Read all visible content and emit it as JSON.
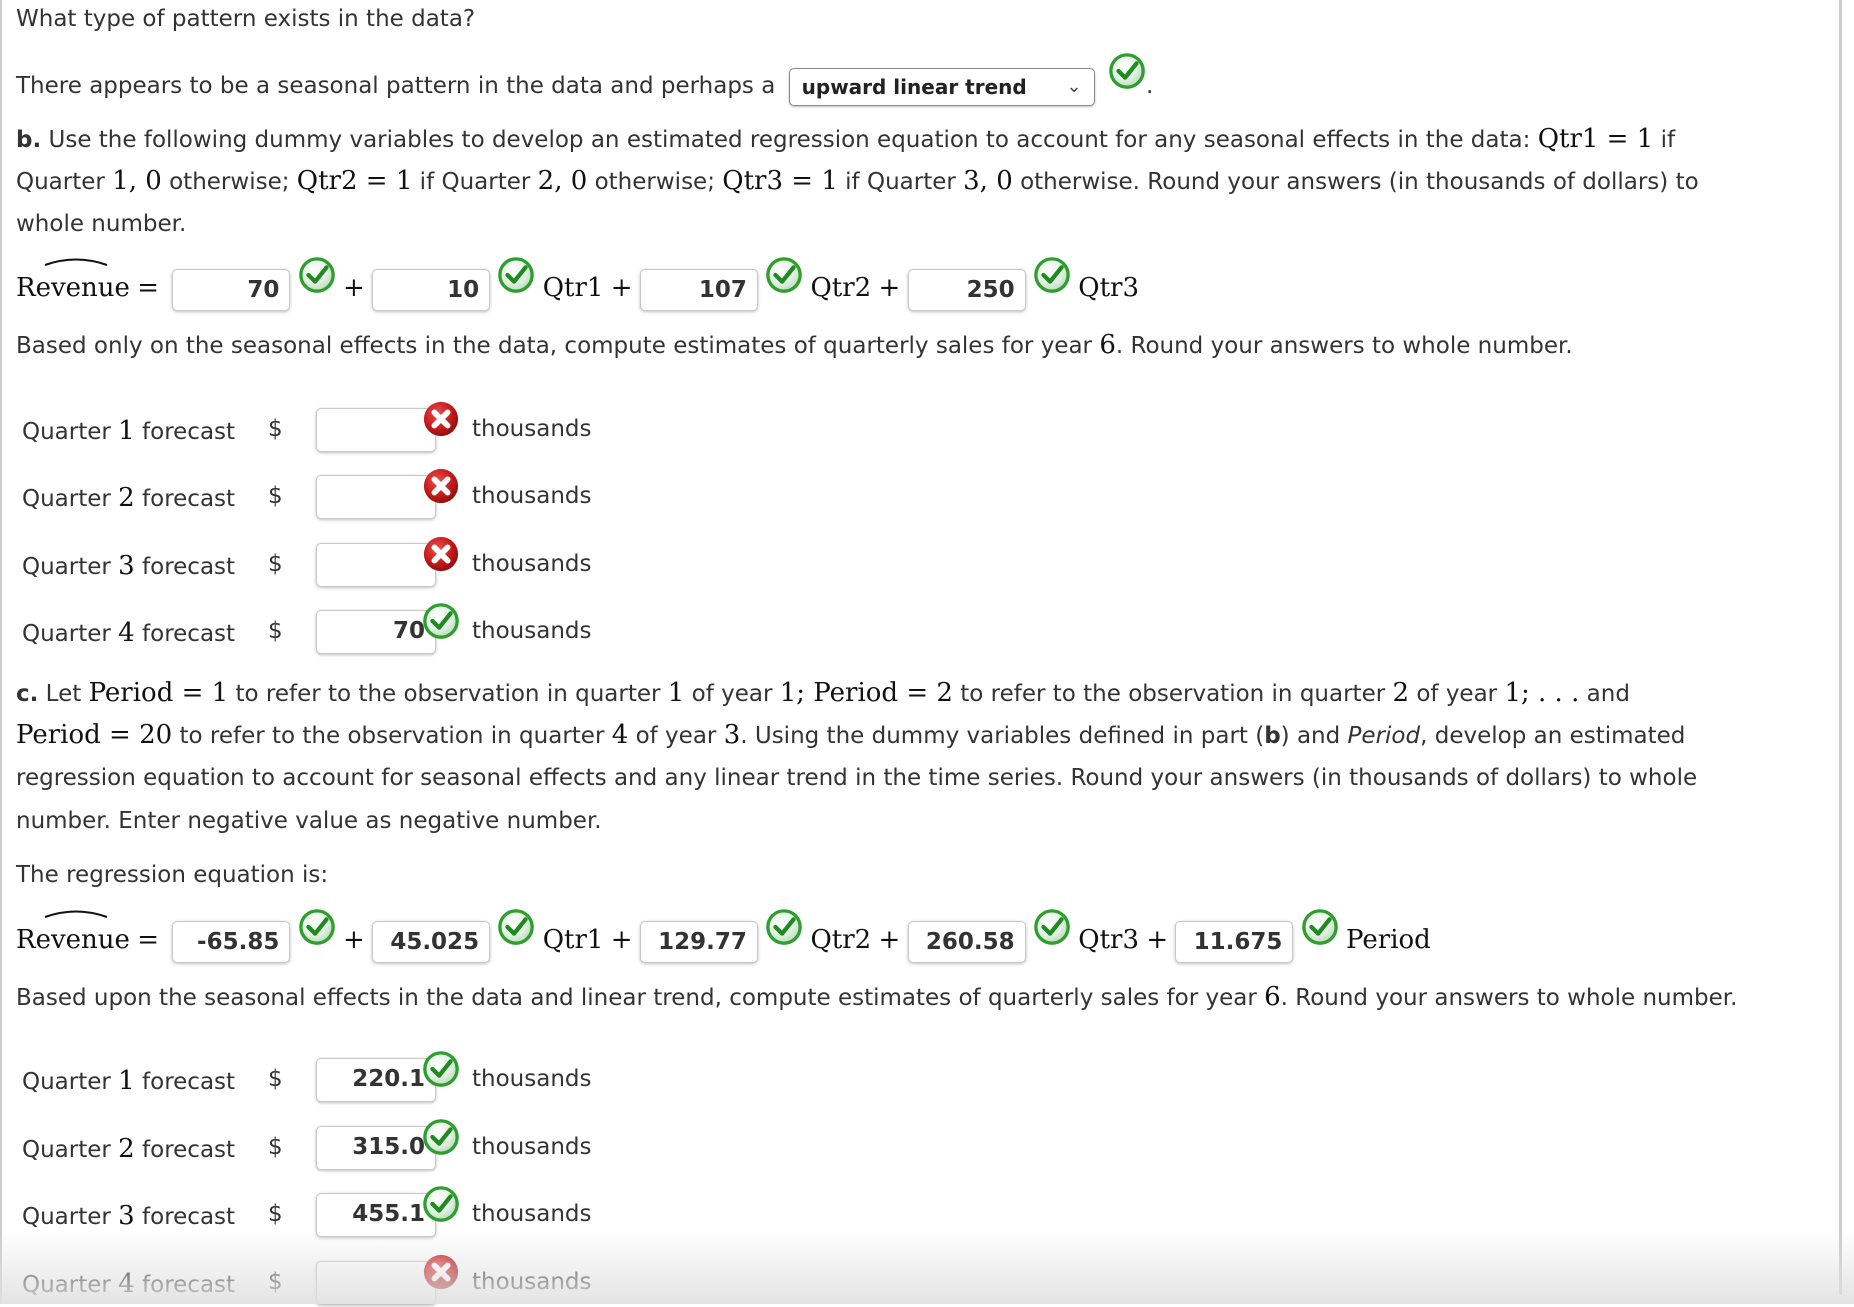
{
  "question": "What type of pattern exists in the data?",
  "pattern_sentence": {
    "prefix": "There appears to be a seasonal pattern in the data and perhaps a",
    "selected": "upward linear trend",
    "suffix": ".",
    "status": "correct"
  },
  "part_b": {
    "label": "b.",
    "text1": " Use the following dummy variables to develop an estimated regression equation to account for any seasonal effects in the data: ",
    "m1": "Qtr1 = 1",
    "text2": " if",
    "line2_a": "Quarter ",
    "m2": "1, 0",
    "line2_b": " otherwise; ",
    "m3": "Qtr2 = 1",
    "line2_c": " if Quarter ",
    "m4": "2, 0",
    "line2_d": " otherwise; ",
    "m5": "Qtr3 = 1",
    "line2_e": " if Quarter ",
    "m6": "3, 0",
    "line2_f": " otherwise. Round your answers (in thousands of dollars) to",
    "line3": "whole number.",
    "equation": {
      "lhs": "Revenue",
      "equals": "=",
      "plus": "+",
      "terms": [
        {
          "value": "70",
          "status": "correct",
          "var": ""
        },
        {
          "value": "10",
          "status": "correct",
          "var": "Qtr1"
        },
        {
          "value": "107",
          "status": "correct",
          "var": "Qtr2"
        },
        {
          "value": "250",
          "status": "correct",
          "var": "Qtr3"
        }
      ]
    },
    "forecast_intro_a": "Based only on the seasonal effects in the data, compute estimates of quarterly sales for year ",
    "forecast_year": "6",
    "forecast_intro_b": ". Round your answers to whole number.",
    "forecasts": [
      {
        "label": "Quarter",
        "q": "1",
        "label2": "forecast",
        "currency": "$",
        "value": "",
        "status": "incorrect",
        "unit": "thousands"
      },
      {
        "label": "Quarter",
        "q": "2",
        "label2": "forecast",
        "currency": "$",
        "value": "",
        "status": "incorrect",
        "unit": "thousands"
      },
      {
        "label": "Quarter",
        "q": "3",
        "label2": "forecast",
        "currency": "$",
        "value": "",
        "status": "incorrect",
        "unit": "thousands"
      },
      {
        "label": "Quarter",
        "q": "4",
        "label2": "forecast",
        "currency": "$",
        "value": "70",
        "status": "correct",
        "unit": "thousands"
      }
    ]
  },
  "part_c": {
    "label": "c.",
    "l1_a": " Let ",
    "l1_m1": "Period = 1",
    "l1_b": " to refer to the observation in quarter ",
    "l1_m2": "1",
    "l1_c": " of year ",
    "l1_m3": "1; Period = 2",
    "l1_d": " to refer to the observation in quarter ",
    "l1_m4": "2",
    "l1_e": " of year ",
    "l1_m5": "1; . . .",
    "l1_f": " and",
    "l2_m1": "Period = 20",
    "l2_a": " to refer to the observation in quarter ",
    "l2_m2": "4",
    "l2_b": " of year ",
    "l2_m3": "3",
    "l2_c": ". Using the dummy variables defined in part (",
    "l2_bold": "b",
    "l2_d": ") and ",
    "l2_italic": "Period",
    "l2_e": ", develop an estimated",
    "l3": "regression equation to account for seasonal effects and any linear trend in the time series. Round your answers (in thousands of dollars) to whole",
    "l4": "number. Enter negative value as negative number.",
    "eq_intro": "The regression equation is:",
    "equation": {
      "lhs": "Revenue",
      "equals": "=",
      "plus": "+",
      "terms": [
        {
          "value": "-65.85",
          "status": "correct",
          "var": ""
        },
        {
          "value": "45.025",
          "status": "correct",
          "var": "Qtr1"
        },
        {
          "value": "129.77",
          "status": "correct",
          "var": "Qtr2"
        },
        {
          "value": "260.58",
          "status": "correct",
          "var": "Qtr3"
        },
        {
          "value": "11.675",
          "status": "correct",
          "var": "Period"
        }
      ]
    },
    "forecast_intro_a": "Based upon the seasonal effects in the data and linear trend, compute estimates of quarterly sales for year ",
    "forecast_year": "6",
    "forecast_intro_b": ". Round your answers to whole number.",
    "forecasts": [
      {
        "label": "Quarter",
        "q": "1",
        "label2": "forecast",
        "currency": "$",
        "value": "220.1",
        "status": "correct",
        "unit": "thousands"
      },
      {
        "label": "Quarter",
        "q": "2",
        "label2": "forecast",
        "currency": "$",
        "value": "315.0",
        "status": "correct",
        "unit": "thousands"
      },
      {
        "label": "Quarter",
        "q": "3",
        "label2": "forecast",
        "currency": "$",
        "value": "455.1",
        "status": "correct",
        "unit": "thousands"
      },
      {
        "label": "Quarter",
        "q": "4",
        "label2": "forecast",
        "currency": "$",
        "value": "",
        "status": "incorrect",
        "unit": "thousands"
      }
    ]
  },
  "colors": {
    "correct": "#2e9e2e",
    "incorrect": "#c41a1a",
    "text": "#333333",
    "border": "#cccccc"
  }
}
